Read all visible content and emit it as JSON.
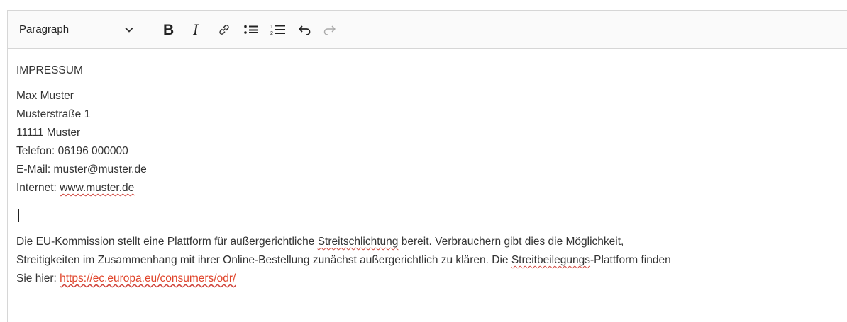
{
  "toolbar": {
    "format_value": "Paragraph",
    "icons": [
      "bold-icon",
      "italic-icon",
      "link-icon",
      "bulleted-list-icon",
      "numbered-list-icon",
      "undo-icon",
      "redo-icon"
    ]
  },
  "content": {
    "heading": "IMPRESSUM",
    "name": "Max Muster",
    "street": "Musterstraße 1",
    "city": "11111 Muster",
    "phone": "Telefon: 06196 000000",
    "email": "E-Mail: muster@muster.de",
    "internet_label": "Internet: ",
    "internet_url": "www.muster.de",
    "para_1": "Die EU-Kommission stellt eine Plattform für außergerichtliche ",
    "para_2": "Streitschlichtung",
    "para_3": " bereit. Verbrauchern gibt dies die Möglichkeit,",
    "para_4": "Streitigkeiten im Zusammenhang mit ihrer Online-Bestellung zunächst außergerichtlich zu klären. Die ",
    "para_5": "Streitbeilegungs",
    "para_6": "-Plattform finden",
    "para_7": "Sie hier: ",
    "odr_link": "https://ec.europa.eu/consumers/odr/"
  },
  "colors": {
    "link": "#e0442a",
    "spellcheck": "#d0453c",
    "border": "#d6d6d6"
  }
}
